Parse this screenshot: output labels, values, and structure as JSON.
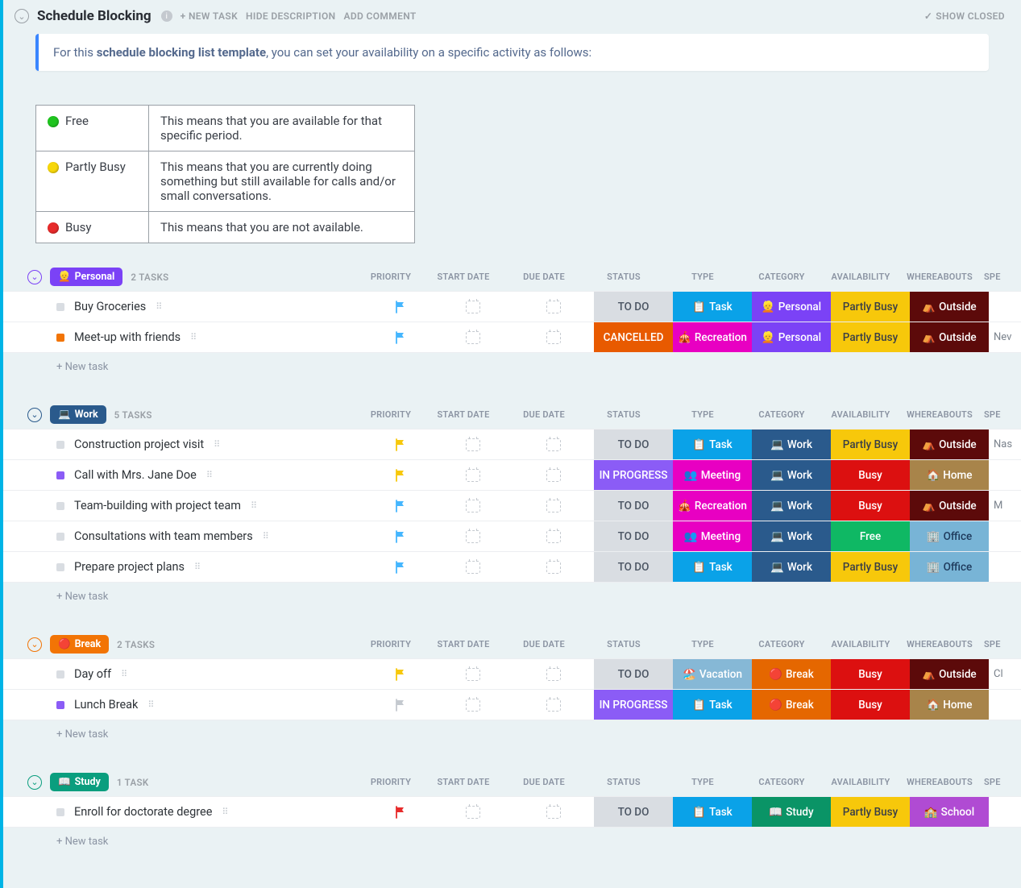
{
  "header": {
    "title": "Schedule Blocking",
    "newTask": "+ NEW TASK",
    "hideDesc": "HIDE DESCRIPTION",
    "addComment": "ADD COMMENT",
    "showClosed": "SHOW CLOSED"
  },
  "description": {
    "prefix": "For this ",
    "bold": "schedule blocking list template",
    "suffix": ", you can set your availability on a specific activity as follows:"
  },
  "legend": [
    {
      "color": "green",
      "label": "Free",
      "text": "This means that you are available for that specific period."
    },
    {
      "color": "yellow",
      "label": "Partly Busy",
      "text": "This means that you are currently doing something but still available for calls and/or small conversations."
    },
    {
      "color": "red",
      "label": "Busy",
      "text": "This means that you are not available."
    }
  ],
  "columns": {
    "priority": "PRIORITY",
    "start": "START DATE",
    "due": "DUE DATE",
    "status": "STATUS",
    "type": "TYPE",
    "category": "CATEGORY",
    "availability": "AVAILABILITY",
    "whereabouts": "WHEREABOUTS",
    "spec": "SPE"
  },
  "newTaskLabel": "+ New task",
  "groups": [
    {
      "id": "personal",
      "label": "Personal",
      "emoji": "👱",
      "color": "#7b42f6",
      "toggleColor": "#7b42f6",
      "count": "2 TASKS",
      "tasks": [
        {
          "square": "#d9dde2",
          "name": "Buy Groceries",
          "flag": "#45b6fe",
          "status": {
            "label": "TO DO",
            "class": "bg-grey"
          },
          "type": {
            "emoji": "📋",
            "label": "Task",
            "class": "bg-blue"
          },
          "category": {
            "emoji": "👱",
            "label": "Personal",
            "class": "bg-purple"
          },
          "availability": {
            "label": "Partly Busy",
            "class": "bg-yellow"
          },
          "where": {
            "emoji": "⛺",
            "label": "Outside",
            "class": "bg-maroon"
          },
          "spec": ""
        },
        {
          "square": "#f27405",
          "name": "Meet-up with friends",
          "flag": "#45b6fe",
          "status": {
            "label": "CANCELLED",
            "class": "bg-orange"
          },
          "type": {
            "emoji": "🎪",
            "label": "Recreation",
            "class": "bg-magenta"
          },
          "category": {
            "emoji": "👱",
            "label": "Personal",
            "class": "bg-purple"
          },
          "availability": {
            "label": "Partly Busy",
            "class": "bg-yellow"
          },
          "where": {
            "emoji": "⛺",
            "label": "Outside",
            "class": "bg-maroon"
          },
          "spec": "Nev"
        }
      ]
    },
    {
      "id": "work",
      "label": "Work",
      "emoji": "💻",
      "color": "#2a5a8c",
      "toggleColor": "#2a5a8c",
      "count": "5 TASKS",
      "tasks": [
        {
          "square": "#d9dde2",
          "name": "Construction project visit",
          "flag": "#f7c80b",
          "status": {
            "label": "TO DO",
            "class": "bg-grey"
          },
          "type": {
            "emoji": "📋",
            "label": "Task",
            "class": "bg-blue"
          },
          "category": {
            "emoji": "💻",
            "label": "Work",
            "class": "bg-dkblue"
          },
          "availability": {
            "label": "Partly Busy",
            "class": "bg-yellow"
          },
          "where": {
            "emoji": "⛺",
            "label": "Outside",
            "class": "bg-maroon"
          },
          "spec": "Nas"
        },
        {
          "square": "#8b5cf6",
          "name": "Call with Mrs. Jane Doe",
          "flag": "#f7c80b",
          "status": {
            "label": "IN PROGRESS",
            "class": "bg-violet"
          },
          "type": {
            "emoji": "👥",
            "label": "Meeting",
            "class": "bg-magenta"
          },
          "category": {
            "emoji": "💻",
            "label": "Work",
            "class": "bg-dkblue"
          },
          "availability": {
            "label": "Busy",
            "class": "bg-red"
          },
          "where": {
            "emoji": "🏠",
            "label": "Home",
            "class": "bg-brown"
          },
          "spec": ""
        },
        {
          "square": "#d9dde2",
          "name": "Team-building with project team",
          "flag": "#45b6fe",
          "status": {
            "label": "TO DO",
            "class": "bg-grey"
          },
          "type": {
            "emoji": "🎪",
            "label": "Recreation",
            "class": "bg-magenta"
          },
          "category": {
            "emoji": "💻",
            "label": "Work",
            "class": "bg-dkblue"
          },
          "availability": {
            "label": "Busy",
            "class": "bg-red"
          },
          "where": {
            "emoji": "⛺",
            "label": "Outside",
            "class": "bg-maroon"
          },
          "spec": "M"
        },
        {
          "square": "#d9dde2",
          "name": "Consultations with team members",
          "flag": "#45b6fe",
          "status": {
            "label": "TO DO",
            "class": "bg-grey"
          },
          "type": {
            "emoji": "👥",
            "label": "Meeting",
            "class": "bg-magenta"
          },
          "category": {
            "emoji": "💻",
            "label": "Work",
            "class": "bg-dkblue"
          },
          "availability": {
            "label": "Free",
            "class": "bg-green"
          },
          "where": {
            "emoji": "🏢",
            "label": "Office",
            "class": "bg-ltblue"
          },
          "spec": ""
        },
        {
          "square": "#d9dde2",
          "name": "Prepare project plans",
          "flag": "#45b6fe",
          "status": {
            "label": "TO DO",
            "class": "bg-grey"
          },
          "type": {
            "emoji": "📋",
            "label": "Task",
            "class": "bg-blue"
          },
          "category": {
            "emoji": "💻",
            "label": "Work",
            "class": "bg-dkblue"
          },
          "availability": {
            "label": "Partly Busy",
            "class": "bg-yellow"
          },
          "where": {
            "emoji": "🏢",
            "label": "Office",
            "class": "bg-ltblue"
          },
          "spec": ""
        }
      ]
    },
    {
      "id": "break",
      "label": "Break",
      "emoji": "🔴",
      "color": "#f27405",
      "toggleColor": "#f27405",
      "count": "2 TASKS",
      "tasks": [
        {
          "square": "#d9dde2",
          "name": "Day off",
          "flag": "#f7c80b",
          "status": {
            "label": "TO DO",
            "class": "bg-grey"
          },
          "type": {
            "emoji": "🏖️",
            "label": "Vacation",
            "class": "bg-ltblue2"
          },
          "category": {
            "emoji": "🔴",
            "label": "Break",
            "class": "bg-dorange"
          },
          "availability": {
            "label": "Busy",
            "class": "bg-red"
          },
          "where": {
            "emoji": "⛺",
            "label": "Outside",
            "class": "bg-maroon"
          },
          "spec": "Cl"
        },
        {
          "square": "#8b5cf6",
          "name": "Lunch Break",
          "flag": "#c4c9cf",
          "status": {
            "label": "IN PROGRESS",
            "class": "bg-violet"
          },
          "type": {
            "emoji": "📋",
            "label": "Task",
            "class": "bg-blue"
          },
          "category": {
            "emoji": "🔴",
            "label": "Break",
            "class": "bg-dorange"
          },
          "availability": {
            "label": "Busy",
            "class": "bg-red"
          },
          "where": {
            "emoji": "🏠",
            "label": "Home",
            "class": "bg-brown"
          },
          "spec": ""
        }
      ]
    },
    {
      "id": "study",
      "label": "Study",
      "emoji": "📖",
      "color": "#0a9e7e",
      "toggleColor": "#0a9e7e",
      "count": "1 TASK",
      "tasks": [
        {
          "square": "#d9dde2",
          "name": "Enroll for doctorate degree",
          "flag": "#e72b2b",
          "status": {
            "label": "TO DO",
            "class": "bg-grey"
          },
          "type": {
            "emoji": "📋",
            "label": "Task",
            "class": "bg-blue"
          },
          "category": {
            "emoji": "📖",
            "label": "Study",
            "class": "bg-emerald"
          },
          "availability": {
            "label": "Partly Busy",
            "class": "bg-yellow"
          },
          "where": {
            "emoji": "🏫",
            "label": "School",
            "class": "bg-fuchsia"
          },
          "spec": ""
        }
      ]
    }
  ]
}
